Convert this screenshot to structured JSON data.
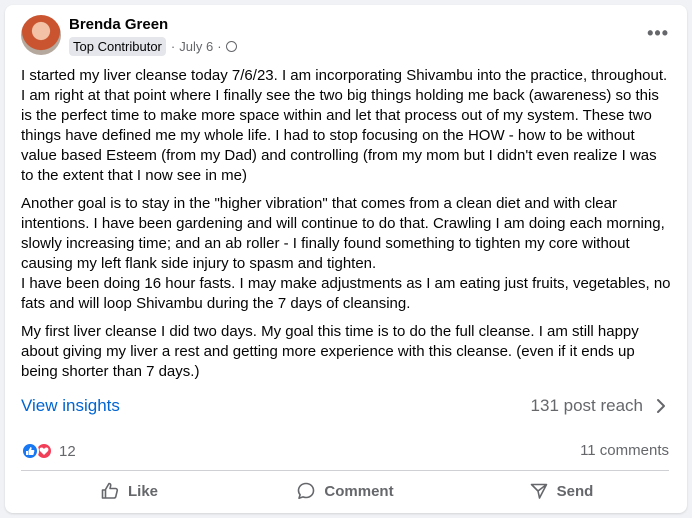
{
  "post": {
    "author": "Brenda Green",
    "badge": "Top Contributor",
    "date": "July 6",
    "separator": "·",
    "more_icon": "more-options-icon",
    "paragraphs": [
      "I started my liver cleanse today 7/6/23. I am incorporating Shivambu into the practice, throughout. I am right at that point where I finally see the two big things holding me back (awareness) so this is the perfect time to make more space within and let that process out of my system. These two things have defined me my whole life. I had to stop focusing on the HOW - how to be without value based Esteem (from my Dad) and controlling (from my mom but I didn't even realize I was to the extent that I now see in me)",
      "Another goal is to stay in the \"higher vibration\" that comes from a clean diet and with clear intentions. I have been gardening and will continue to do that. Crawling I am doing each morning, slowly increasing time; and an ab roller - I finally found something to tighten my core without causing my left flank side injury to spasm and tighten.\nI have been doing 16 hour fasts. I may make adjustments as I am eating just fruits, vegetables, no fats and  will loop Shivambu during the 7 days of cleansing.",
      "My first liver cleanse I did two days. My goal this time is to do the full cleanse. I am still happy about giving my liver a rest and getting more experience with this cleanse. (even if it ends up being shorter than 7 days.)"
    ]
  },
  "insights": {
    "link_label": "View insights",
    "reach_label": "131 post reach"
  },
  "stats": {
    "reaction_count": "12",
    "comments_label": "11 comments"
  },
  "actions": {
    "like": "Like",
    "comment": "Comment",
    "send": "Send"
  },
  "colors": {
    "link": "#0064d1",
    "like_reaction": "#1877f2",
    "love_reaction": "#f33e58",
    "secondary_text": "#65676b"
  }
}
